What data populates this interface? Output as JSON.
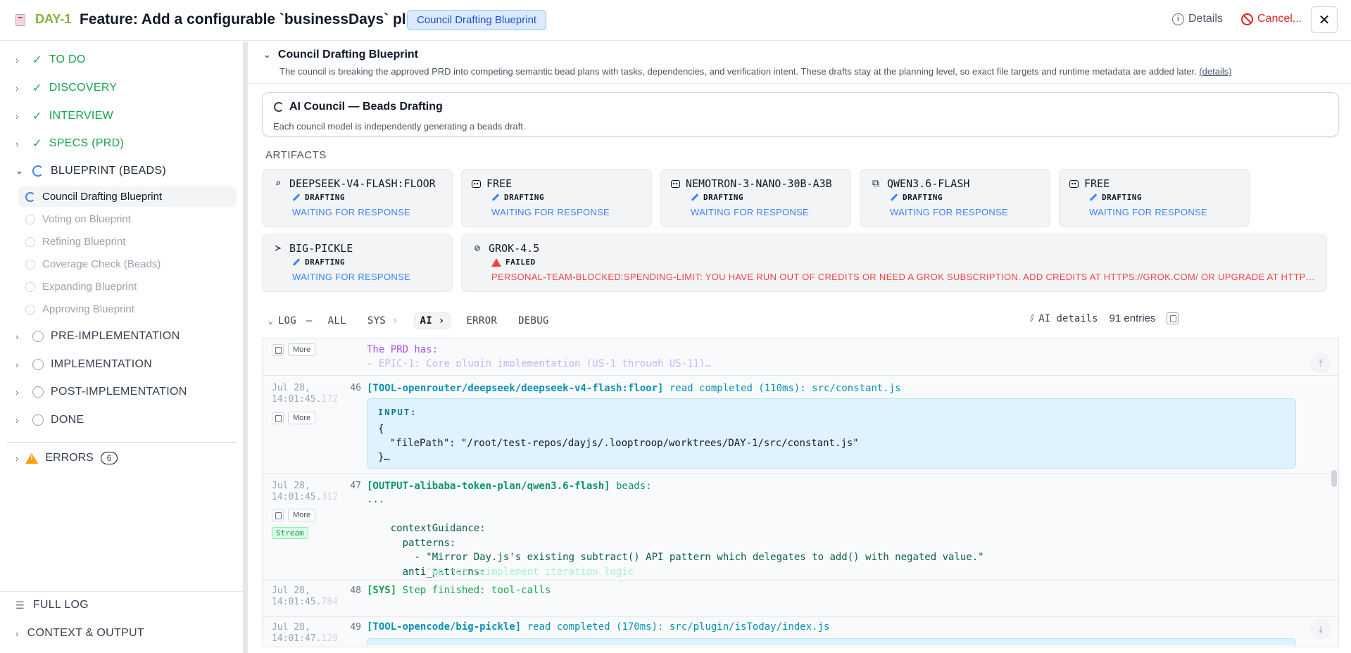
{
  "header": {
    "ticket_id": "DAY-1",
    "title": "Feature: Add a configurable `businessDays` plugin",
    "badge": "Council Drafting Blueprint",
    "details_label": "Details",
    "cancel_label": "Cancel...",
    "close_glyph": "✕"
  },
  "sidebar": {
    "phases": [
      {
        "label": "TO DO",
        "state": "done"
      },
      {
        "label": "DISCOVERY",
        "state": "done"
      },
      {
        "label": "INTERVIEW",
        "state": "done"
      },
      {
        "label": "SPECS (PRD)",
        "state": "done"
      },
      {
        "label": "BLUEPRINT (BEADS)",
        "state": "active"
      },
      {
        "label": "PRE-IMPLEMENTATION",
        "state": "todo"
      },
      {
        "label": "IMPLEMENTATION",
        "state": "todo"
      },
      {
        "label": "POST-IMPLEMENTATION",
        "state": "todo"
      },
      {
        "label": "DONE",
        "state": "todo"
      }
    ],
    "substeps": [
      {
        "label": "Council Drafting Blueprint",
        "current": true
      },
      {
        "label": "Voting on Blueprint"
      },
      {
        "label": "Refining Blueprint"
      },
      {
        "label": "Coverage Check (Beads)"
      },
      {
        "label": "Expanding Blueprint"
      },
      {
        "label": "Approving Blueprint"
      }
    ],
    "errors_label": "ERRORS",
    "errors_count": "6",
    "full_log_label": "FULL LOG",
    "context_label": "CONTEXT & OUTPUT"
  },
  "main": {
    "section_title": "Council Drafting Blueprint",
    "section_desc": "The council is breaking the approved PRD into competing semantic bead plans with tasks, dependencies, and verification intent. These drafts stay at the planning level, so exact file targets and runtime metadata are added later.",
    "section_link": "(details)",
    "council_title": "AI Council — Beads Drafting",
    "council_desc": "Each council model is independently generating a beads draft.",
    "artifacts_label": "ARTIFACTS",
    "cards": [
      {
        "icon": "search-model-icon",
        "glyph": "⌕",
        "name": "DEEPSEEK-V4-FLASH:FLOOR",
        "status": "DRAFTING",
        "note": "WAITING FOR RESPONSE"
      },
      {
        "icon": "robot-icon",
        "name": "FREE",
        "status": "DRAFTING",
        "note": "WAITING FOR RESPONSE"
      },
      {
        "icon": "robot-icon",
        "name": "NEMOTRON-3-NANO-30B-A3B",
        "status": "DRAFTING",
        "note": "WAITING FOR RESPONSE"
      },
      {
        "icon": "blocks-icon",
        "glyph": "⧉",
        "name": "QWEN3.6-FLASH",
        "status": "DRAFTING",
        "note": "WAITING FOR RESPONSE"
      },
      {
        "icon": "robot-icon",
        "name": "FREE",
        "status": "DRAFTING",
        "note": "WAITING FOR RESPONSE"
      },
      {
        "icon": "terminal-icon",
        "glyph": "≻",
        "name": "BIG-PICKLE",
        "status": "DRAFTING",
        "note": "WAITING FOR RESPONSE"
      },
      {
        "icon": "grok-icon",
        "glyph": "⊘",
        "name": "GROK-4.5",
        "status": "FAILED",
        "note": "PERSONAL-TEAM-BLOCKED:SPENDING-LIMIT: YOU HAVE RUN OUT OF CREDITS OR NEED A GROK SUBSCRIPTION. ADD CREDITS AT HTTPS://GROK.COM/ OR UPGRADE AT HTTPS://GROK.COM/PLANS"
      }
    ]
  },
  "log": {
    "label": "LOG",
    "dash": "—",
    "tabs": [
      "ALL",
      "SYS",
      "AI",
      "ERROR",
      "DEBUG"
    ],
    "active_tab": "AI",
    "ai_details": "AI details",
    "entries_count": "91 entries",
    "more_label": "More",
    "stream_label": "Stream",
    "rows": [
      {
        "msg1": "The PRD has:",
        "msg2": "- EPIC-1: Core plugin implementation (US-1 through US-11)…"
      },
      {
        "date": "Jul 28,",
        "time": "14:01:45.",
        "ms": "172",
        "num": "46",
        "tag": "[TOOL-openrouter/deepseek/deepseek-v4-flash:floor]",
        "text": " read completed (110ms): src/constant.js",
        "input_label": "INPUT:",
        "code": "{\n  \"filePath\": \"/root/test-repos/dayjs/.looptroop/worktrees/DAY-1/src/constant.js\"\n}…"
      },
      {
        "date": "Jul 28,",
        "time": "14:01:45.",
        "ms": "312",
        "num": "47",
        "tag": "[OUTPUT-alibaba-token-plan/qwen3.6-flash]",
        "text": " beads:",
        "code": "...\n\n    contextGuidance:\n      patterns:\n        - \"Mirror Day.js's existing subtract() API pattern which delegates to add() with negated value.\"\n      anti_patterns:",
        "faded": "        - \"Do not reimplement iteration logic"
      },
      {
        "date": "Jul 28,",
        "time": "14:01:45.",
        "ms": "784",
        "num": "48",
        "tag": "[SYS]",
        "text": " Step finished: tool-calls"
      },
      {
        "date": "Jul 28,",
        "time": "14:01:47.",
        "ms": "129",
        "num": "49",
        "tag": "[TOOL-opencode/big-pickle]",
        "text": " read completed (170ms): src/plugin/isToday/index.js"
      }
    ]
  }
}
